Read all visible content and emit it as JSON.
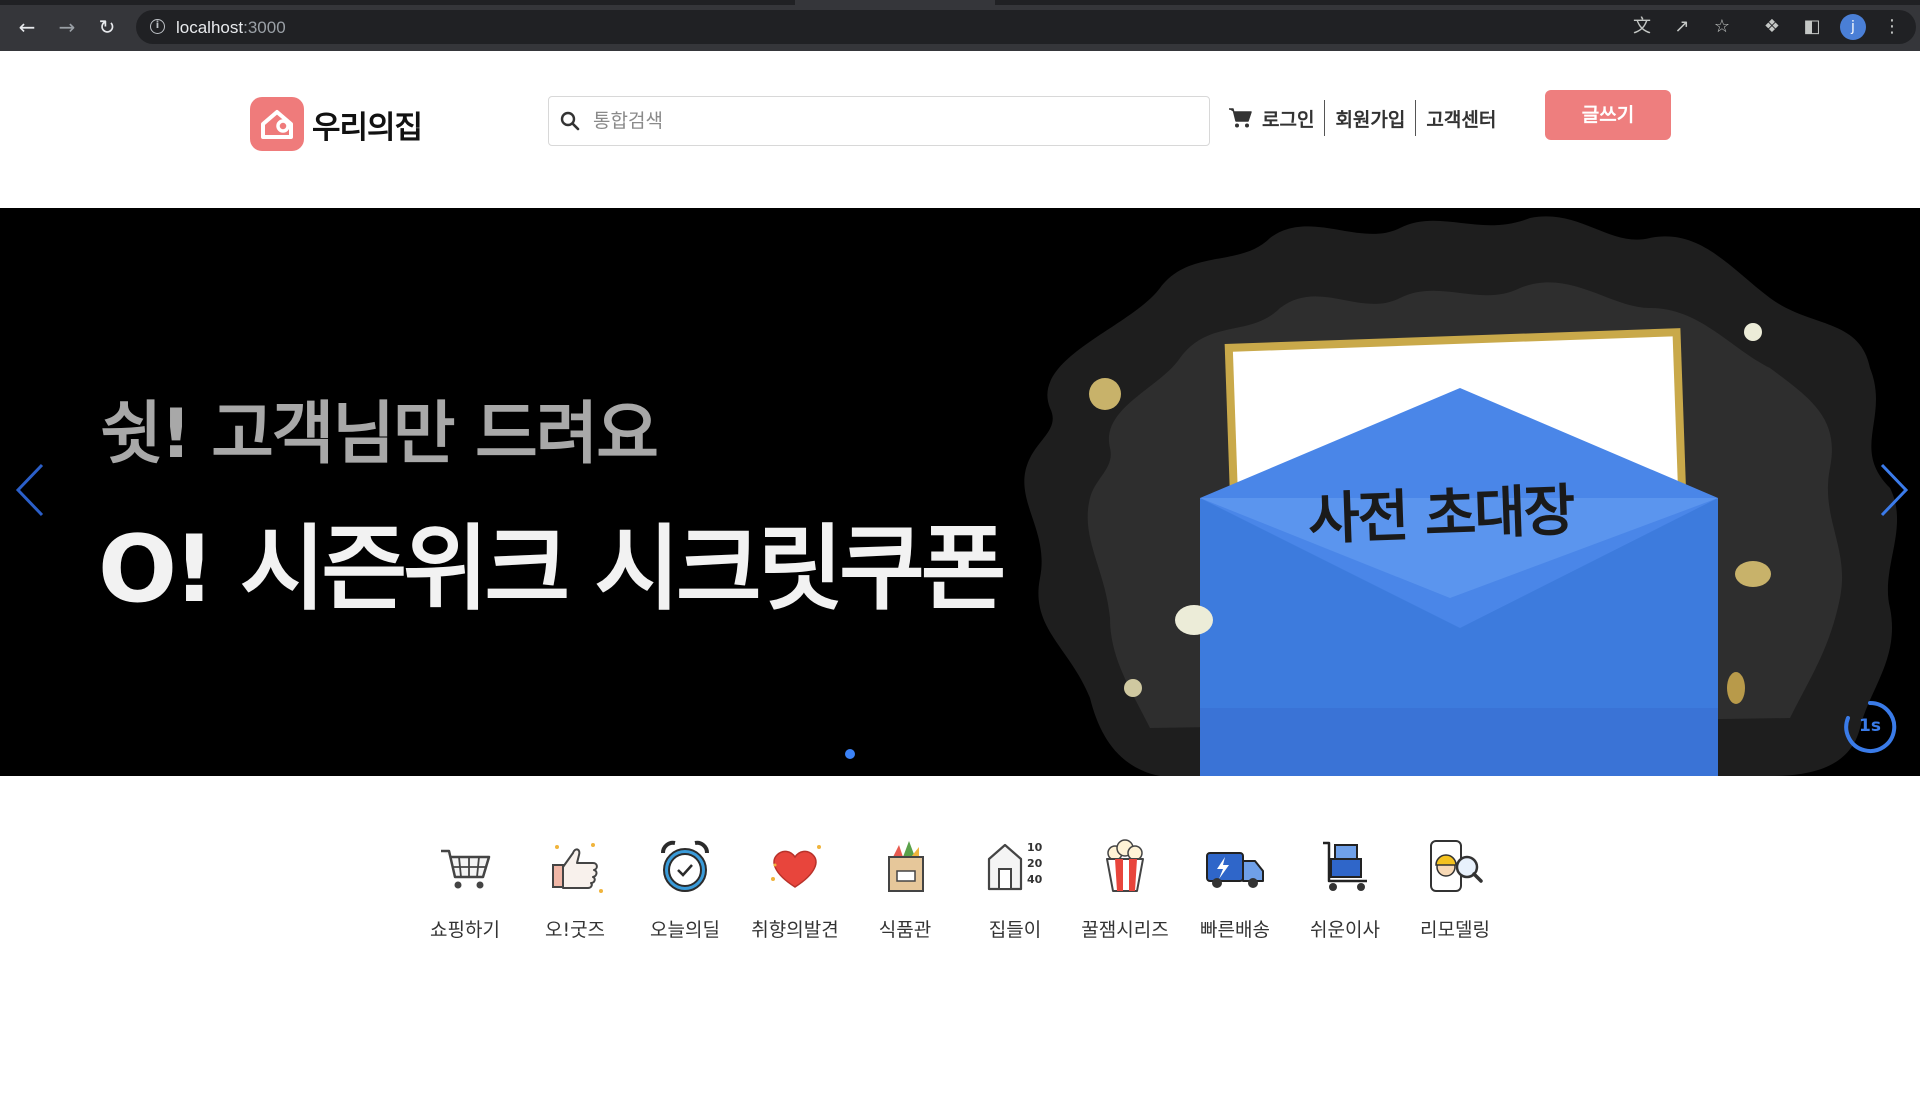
{
  "browser": {
    "url_host": "localhost",
    "url_port": ":3000",
    "profile_initial": "j"
  },
  "header": {
    "logo_text": "우리의집",
    "search_placeholder": "통합검색",
    "nav": {
      "login": "로그인",
      "signup": "회원가입",
      "support": "고객센터"
    },
    "write_button": "글쓰기"
  },
  "banner": {
    "subtitle": "쉿! 고객님만 드려요",
    "headline": "O! 시즌위크 시크릿쿠폰",
    "card_text": "사전 초대장",
    "timer": "1s",
    "slides_total": 1,
    "active_slide": 1,
    "colors": {
      "envelope": "#4a86e8",
      "accent_dot": "#3b82f6"
    }
  },
  "categories": [
    {
      "label": "쇼핑하기",
      "icon": "shopping-cart-icon"
    },
    {
      "label": "오!굿즈",
      "icon": "thumbs-up-icon"
    },
    {
      "label": "오늘의딜",
      "icon": "alarm-clock-icon"
    },
    {
      "label": "취향의발견",
      "icon": "heart-icon"
    },
    {
      "label": "식품관",
      "icon": "grocery-bag-icon"
    },
    {
      "label": "집들이",
      "icon": "house-ages-icon",
      "badge_lines": [
        "10",
        "20",
        "40"
      ]
    },
    {
      "label": "꿀잼시리즈",
      "icon": "popcorn-icon"
    },
    {
      "label": "빠른배송",
      "icon": "delivery-truck-icon"
    },
    {
      "label": "쉬운이사",
      "icon": "moving-cart-icon"
    },
    {
      "label": "리모델링",
      "icon": "remodeling-worker-icon"
    }
  ],
  "theme": {
    "brand": "#ef7b7b"
  }
}
